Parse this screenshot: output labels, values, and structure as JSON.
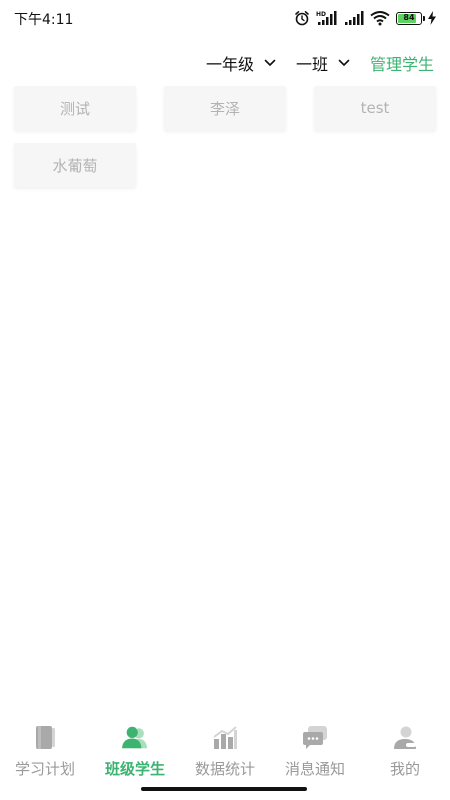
{
  "status_bar": {
    "time": "下午4:11",
    "battery_level": "84",
    "battery_percent": 84
  },
  "filters": {
    "grade": "一年级",
    "class": "一班",
    "manage_label": "管理学生"
  },
  "students": [
    {
      "name": "测试"
    },
    {
      "name": "李泽"
    },
    {
      "name": "test"
    },
    {
      "name": "水葡萄"
    }
  ],
  "bottom_nav": {
    "items": [
      {
        "label": "学习计划",
        "icon": "book-icon",
        "active": false
      },
      {
        "label": "班级学生",
        "icon": "students-icon",
        "active": true
      },
      {
        "label": "数据统计",
        "icon": "chart-icon",
        "active": false
      },
      {
        "label": "消息通知",
        "icon": "message-icon",
        "active": false
      },
      {
        "label": "我的",
        "icon": "profile-icon",
        "active": false
      }
    ]
  },
  "colors": {
    "accent": "#3cb371",
    "inactive": "#999999",
    "card_bg": "#f6f6f6",
    "card_text": "#b3b3b3"
  }
}
